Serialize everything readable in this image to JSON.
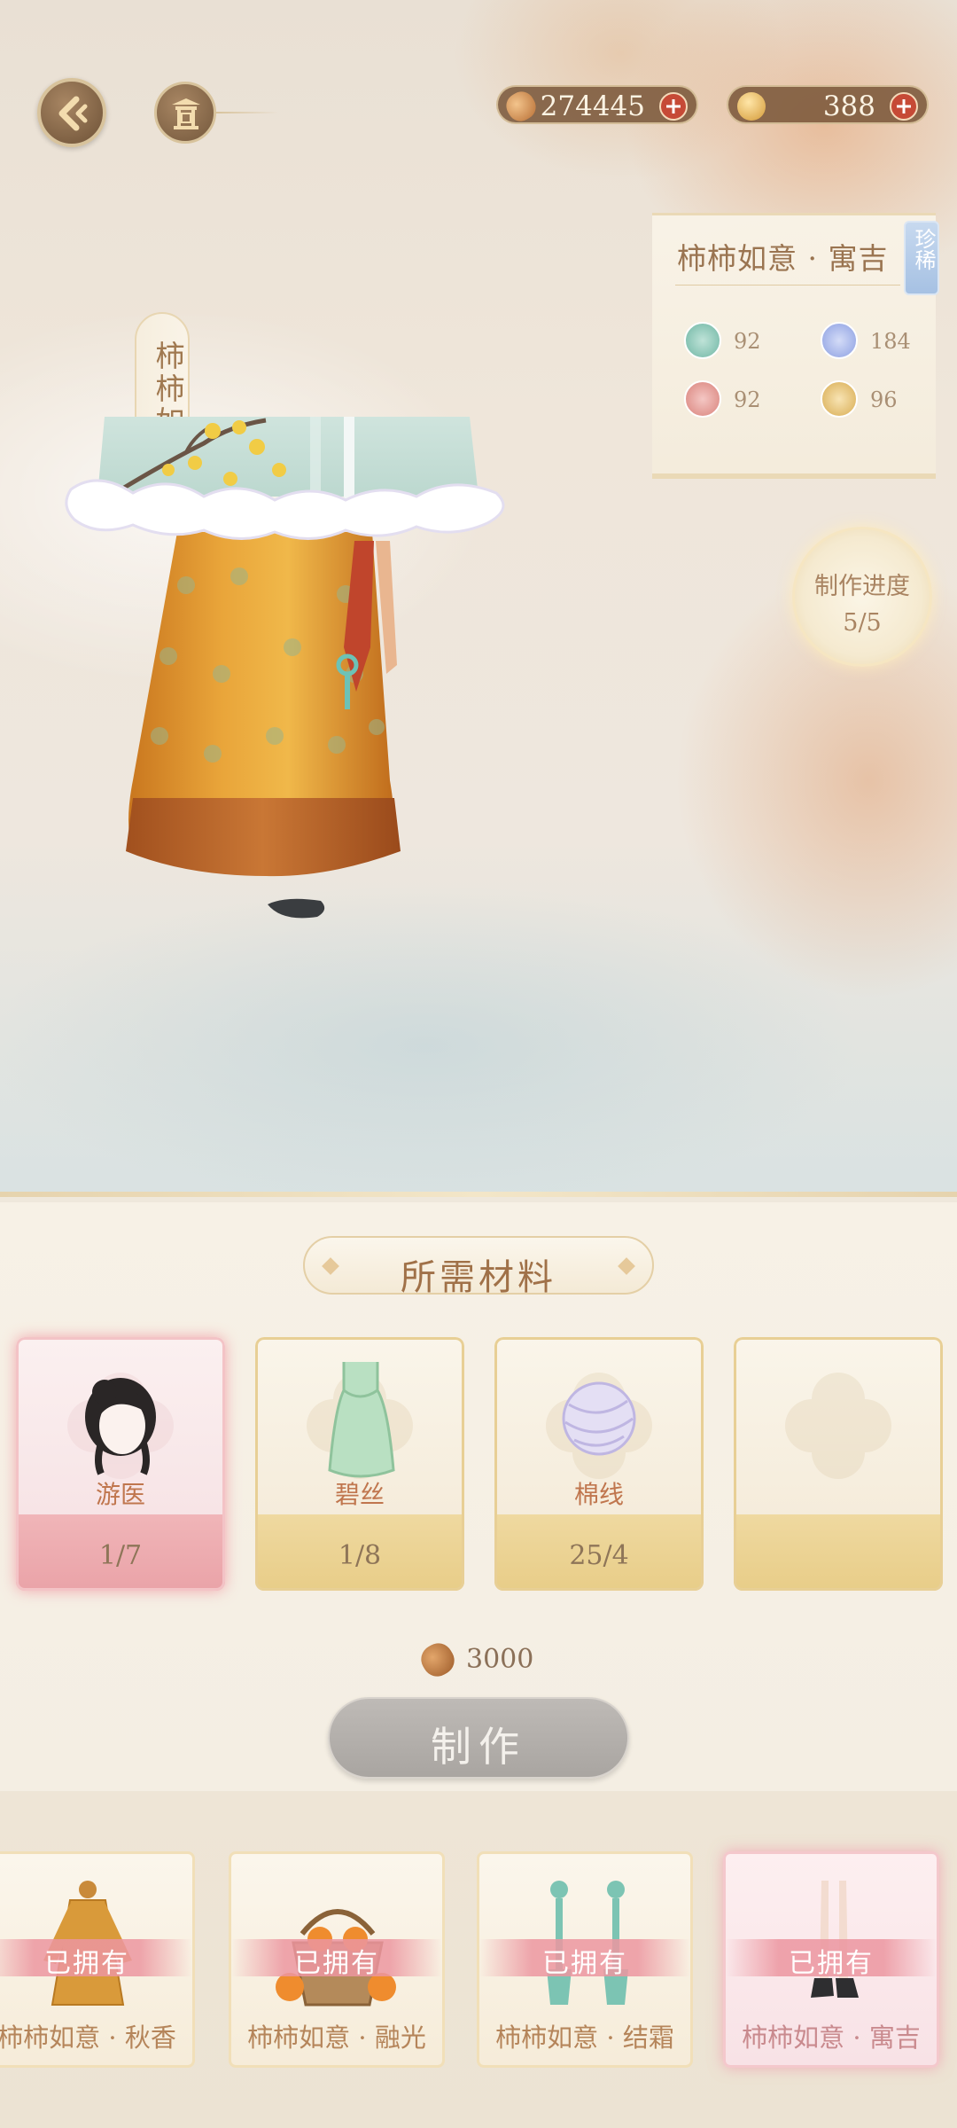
{
  "currencies": {
    "copper": {
      "icon": "copper-coin-icon",
      "value": "274445"
    },
    "gold": {
      "icon": "gold-ingot-icon",
      "value": "388"
    }
  },
  "garment": {
    "vertical_title": "柿柿如意"
  },
  "info": {
    "name": "柿柿如意 · 寓吉",
    "rarity": "珍稀",
    "stats": [
      {
        "icon": "elegance-icon",
        "color": "#6fb6a4",
        "value": "92"
      },
      {
        "icon": "freshness-icon",
        "color": "#8c9fe2",
        "value": "184"
      },
      {
        "icon": "sweetness-icon",
        "color": "#d9827b",
        "value": "92"
      },
      {
        "icon": "maturity-icon",
        "color": "#d8ac52",
        "value": "96"
      }
    ]
  },
  "progress": {
    "label": "制作进度",
    "value": "5/5"
  },
  "materials": {
    "title": "所需材料",
    "items": [
      {
        "name": "游医",
        "count": "1/7",
        "highlight": true
      },
      {
        "name": "碧丝",
        "count": "1/8",
        "highlight": false
      },
      {
        "name": "棉线",
        "count": "25/4",
        "highlight": false
      },
      {
        "name": "",
        "count": "",
        "highlight": false
      }
    ],
    "cost": "3000",
    "make_label": "制作"
  },
  "outfits": [
    {
      "owned_label": "已拥有",
      "name": "柿柿如意 · 秋香",
      "active": false
    },
    {
      "owned_label": "已拥有",
      "name": "柿柿如意 · 融光",
      "active": false
    },
    {
      "owned_label": "已拥有",
      "name": "柿柿如意 · 结霜",
      "active": false
    },
    {
      "owned_label": "已拥有",
      "name": "柿柿如意 · 寓吉",
      "active": true
    }
  ],
  "colors": {
    "accent": "#a07148",
    "highlight_pink": "#eaa3a8",
    "card_gold": "#e8cd88",
    "button_disabled": "#a9a5a1"
  }
}
